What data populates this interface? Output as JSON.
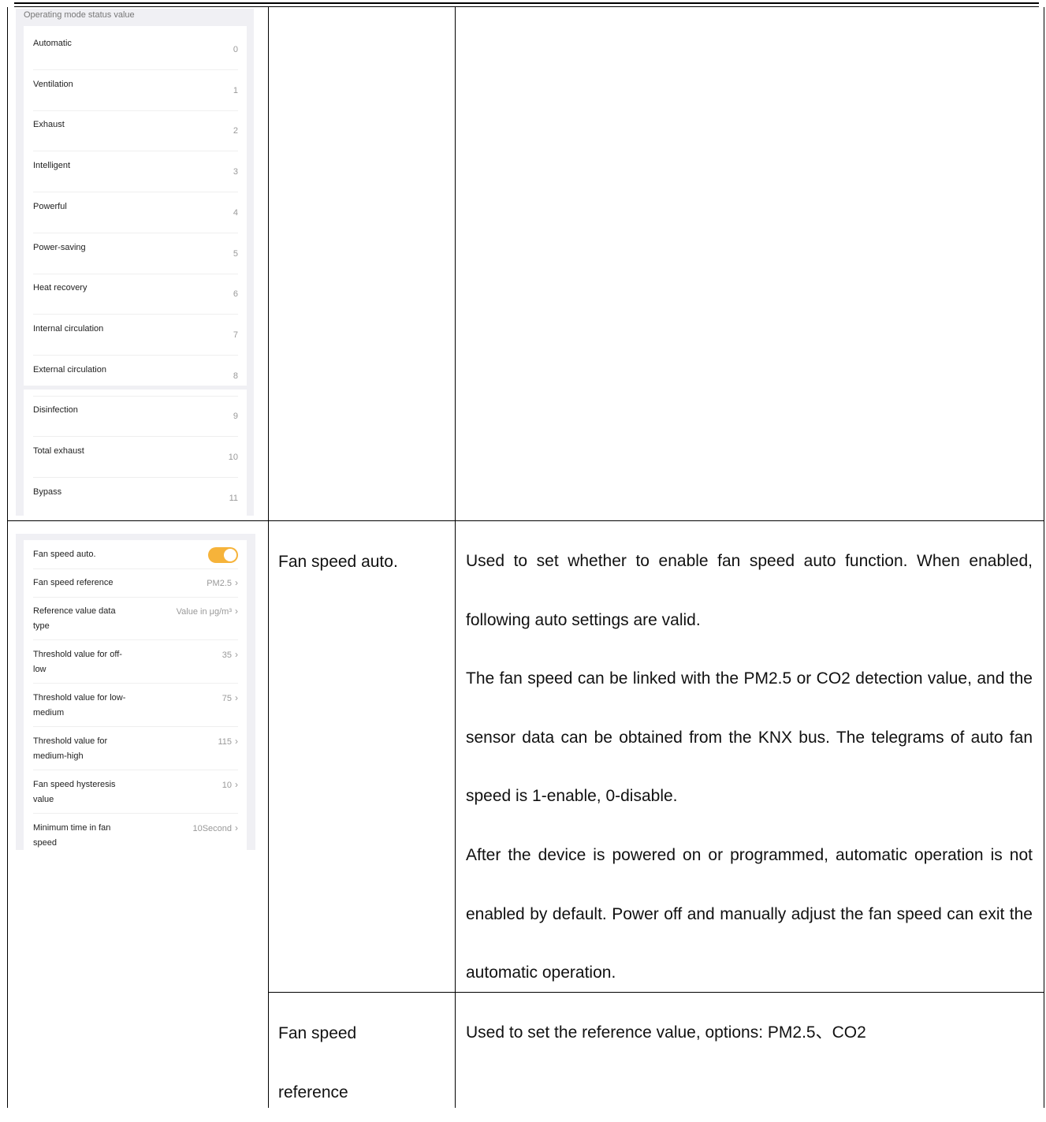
{
  "mode_status_panel": {
    "title": "Operating mode status value",
    "items": [
      {
        "label": "Automatic",
        "value": "0"
      },
      {
        "label": "Ventilation",
        "value": "1"
      },
      {
        "label": "Exhaust",
        "value": "2"
      },
      {
        "label": "Intelligent",
        "value": "3"
      },
      {
        "label": "Powerful",
        "value": "4"
      },
      {
        "label": "Power-saving",
        "value": "5"
      },
      {
        "label": "Heat recovery",
        "value": "6"
      },
      {
        "label": "Internal circulation",
        "value": "7"
      },
      {
        "label": "External circulation",
        "value": "8"
      },
      {
        "label": "Disinfection",
        "value": "9"
      },
      {
        "label": "Total exhaust",
        "value": "10"
      },
      {
        "label": "Bypass",
        "value": "11"
      }
    ]
  },
  "fan_settings_panel": {
    "toggle": {
      "label": "Fan speed auto.",
      "on": true,
      "color": "#f6b33a"
    },
    "rows": [
      {
        "label": "Fan speed reference",
        "value": "PM2.5"
      },
      {
        "label": "Reference value data type",
        "value": "Value in μg/m³"
      },
      {
        "label": "Threshold value for off-low",
        "value": "35"
      },
      {
        "label": "Threshold value for low-medium",
        "value": "75"
      },
      {
        "label": "Threshold value for medium-high",
        "value": "115"
      },
      {
        "label": "Fan speed hysteresis value",
        "value": "10"
      },
      {
        "label": "Minimum time in fan speed",
        "value": "10Second"
      }
    ]
  },
  "table": {
    "row1": {
      "name": "Fan speed auto.",
      "paragraphs": [
        "Used to set whether to enable fan speed auto function. When enabled, following auto settings are valid.",
        "The fan speed can be linked with the PM2.5 or CO2 detection value, and the sensor data can be obtained from the KNX bus. The telegrams of auto fan speed is 1-enable, 0-disable.",
        "After the device is powered on or programmed, automatic operation is not enabled by default. Power off and manually adjust the fan speed can exit the automatic operation."
      ]
    },
    "row2": {
      "name": "Fan speed reference",
      "description": "Used to set the reference value, options: PM2.5、CO2"
    }
  }
}
